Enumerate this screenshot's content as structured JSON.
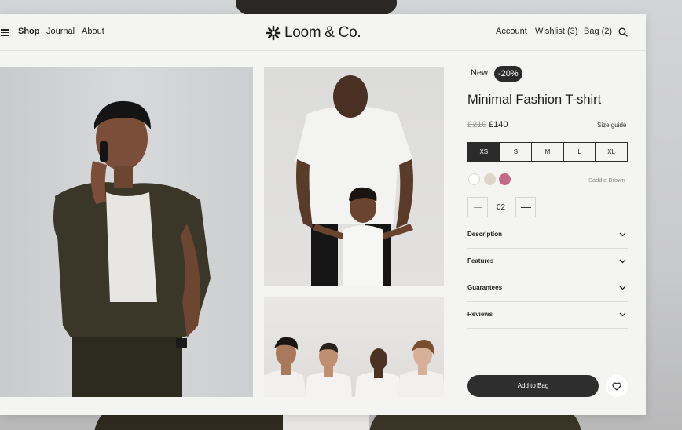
{
  "nav": {
    "left_links": [
      "Shop",
      "Journal",
      "About"
    ],
    "active_link": "Shop",
    "brand": "Loom & Co.",
    "account": "Account",
    "wishlist": "Wishlist (3)",
    "bag": "Bag (2)"
  },
  "product": {
    "badge_new": "New",
    "badge_discount": "-20%",
    "title": "Minimal Fashion T-shirt",
    "old_price": "£210",
    "price": "£140",
    "size_guide": "Size guide",
    "sizes": [
      "XS",
      "S",
      "M",
      "L",
      "XL"
    ],
    "selected_size": "XS",
    "swatches": [
      "#ffffff",
      "#ddd6c8",
      "#c46a89"
    ],
    "color_name": "Saddle Brown",
    "quantity": "02",
    "accordions": [
      "Description",
      "Features",
      "Guarantees",
      "Reviews"
    ],
    "add_to_bag": "Add to Bag"
  },
  "icons": [
    "menu-icon",
    "logo-mark-icon",
    "search-icon",
    "minus-icon",
    "plus-icon",
    "chevron-down-icon",
    "heart-icon"
  ],
  "colors": {
    "dark": "#2b2b2b",
    "panel": "#f4f4f2",
    "sale_badge": "#2b2b2b"
  }
}
